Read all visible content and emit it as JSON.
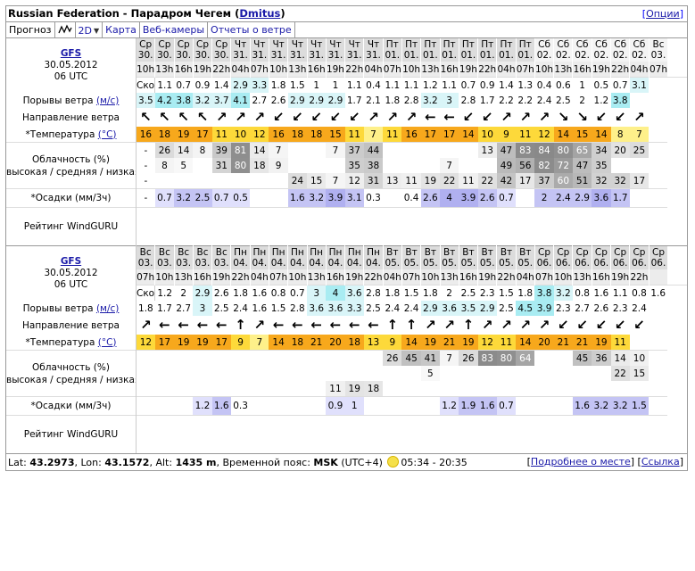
{
  "header": {
    "title": "Russian Federation - Парадром Чегем",
    "user_link": "Dmitus",
    "options_label": "Опции"
  },
  "tabs": [
    {
      "label": "Прогноз",
      "active": true
    },
    {
      "label": "graph-icon",
      "icon": true
    },
    {
      "label": "2D",
      "select": true
    },
    {
      "label": "Карта"
    },
    {
      "label": "Веб-камеры"
    },
    {
      "label": "Отчеты о ветре"
    }
  ],
  "labels": {
    "wind_speed": "Скорость ветра",
    "wind_gust": "Порывы ветра",
    "wind_unit": "(м/с)",
    "wind_dir": "Направление ветра",
    "temp": "*Температура",
    "temp_unit": "(°C)",
    "cloud1": "Облачность (%)",
    "cloud2": "высокая / средняя / низкая",
    "precip": "*Осадки (мм/3ч)",
    "rating": "Рейтинг WindGURU"
  },
  "colors": {
    "wind_light": "#d9f5f8",
    "wind_med": "#a9ecf2",
    "temp_orange": "#f7a81c",
    "temp_yellow": "#fdd93a",
    "temp_lightyellow": "#fef08a",
    "precip_light": "#e0e0fc",
    "precip_med": "#c4c4f4"
  },
  "blocks": [
    {
      "model": "GFS",
      "date": "30.05.2012",
      "utc": "06 UTC",
      "days": [
        "Ср",
        "Ср",
        "Ср",
        "Ср",
        "Ср",
        "Чт",
        "Чт",
        "Чт",
        "Чт",
        "Чт",
        "Чт",
        "Чт",
        "Чт",
        "Пт",
        "Пт",
        "Пт",
        "Пт",
        "Пт",
        "Пт",
        "Пт",
        "Пт",
        "Сб",
        "Сб",
        "Сб",
        "Сб",
        "Сб",
        "Сб",
        "Вс"
      ],
      "dates": [
        "30.",
        "30.",
        "30.",
        "30.",
        "30.",
        "31.",
        "31.",
        "31.",
        "31.",
        "31.",
        "31.",
        "31.",
        "31.",
        "01.",
        "01.",
        "01.",
        "01.",
        "01.",
        "01.",
        "01.",
        "01.",
        "02.",
        "02.",
        "02.",
        "02.",
        "02.",
        "02.",
        "03."
      ],
      "hours": [
        "10h",
        "13h",
        "16h",
        "19h",
        "22h",
        "04h",
        "07h",
        "10h",
        "13h",
        "16h",
        "19h",
        "22h",
        "04h",
        "07h",
        "10h",
        "13h",
        "16h",
        "19h",
        "22h",
        "04h",
        "07h",
        "10h",
        "13h",
        "16h",
        "19h",
        "22h",
        "04h",
        "07h"
      ],
      "weekend_from": 21,
      "speed": [
        "1.1",
        "0.7",
        "0.9",
        "1.4",
        "2.9",
        "3.3",
        "1.8",
        "1.5",
        "1",
        "1",
        "1.1",
        "0.4",
        "1.1",
        "1.1",
        "1.2",
        "1.1",
        "0.7",
        "0.9",
        "1.4",
        "1.3",
        "0.4",
        "0.6",
        "1",
        "0.5",
        "0.7",
        "3.1",
        "",
        ""
      ],
      "gust": [
        "3.5",
        "4.2",
        "3.8",
        "3.2",
        "3.7",
        "4.1",
        "2.7",
        "2.6",
        "2.9",
        "2.9",
        "2.9",
        "1.7",
        "2.1",
        "1.8",
        "2.8",
        "3.2",
        "3",
        "2.8",
        "1.7",
        "2.2",
        "2.2",
        "2.4",
        "2.5",
        "2",
        "1.2",
        "3.8",
        "",
        ""
      ],
      "dir": [
        "↖",
        "↖",
        "↖",
        "↖",
        "↗",
        "↗",
        "↗",
        "↙",
        "↙",
        "↙",
        "↙",
        "↙",
        "↗",
        "↗",
        "↗",
        "←",
        "←",
        "↙",
        "↙",
        "↗",
        "↗",
        "↗",
        "↘",
        "↘",
        "↙",
        "↙",
        "↗",
        ""
      ],
      "temp": [
        "16",
        "18",
        "19",
        "17",
        "11",
        "10",
        "12",
        "16",
        "18",
        "18",
        "15",
        "11",
        "7",
        "11",
        "16",
        "17",
        "17",
        "14",
        "10",
        "9",
        "11",
        "12",
        "14",
        "15",
        "14",
        "8",
        "7",
        ""
      ],
      "cloud_high": [
        "-",
        "26",
        "14",
        "8",
        "39",
        "81",
        "14",
        "7",
        "",
        "",
        "7",
        "37",
        "44",
        "",
        "",
        "",
        "",
        "",
        "13",
        "47",
        "83",
        "84",
        "80",
        "65",
        "34",
        "20",
        "25",
        ""
      ],
      "cloud_mid": [
        "-",
        "8",
        "5",
        "",
        "31",
        "80",
        "18",
        "9",
        "",
        "",
        "",
        "35",
        "38",
        "",
        "",
        "",
        "7",
        "",
        "",
        "49",
        "56",
        "82",
        "72",
        "47",
        "35",
        "",
        ""
      ],
      "cloud_low": [
        "-",
        "",
        "",
        "",
        "",
        "",
        "",
        "",
        "24",
        "15",
        "7",
        "12",
        "31",
        "13",
        "11",
        "19",
        "22",
        "11",
        "22",
        "42",
        "17",
        "37",
        "60",
        "51",
        "32",
        "32",
        "17",
        ""
      ],
      "precip": [
        "-",
        "0.7",
        "3.2",
        "2.5",
        "0.7",
        "0.5",
        "",
        "",
        "1.6",
        "3.2",
        "3.9",
        "3.1",
        "0.3",
        "",
        "0.4",
        "2.6",
        "4",
        "3.9",
        "2.6",
        "0.7",
        "",
        "2",
        "2.4",
        "2.9",
        "3.6",
        "1.7",
        "",
        ""
      ]
    },
    {
      "model": "GFS",
      "date": "30.05.2012",
      "utc": "06 UTC",
      "days": [
        "Вс",
        "Вс",
        "Вс",
        "Вс",
        "Вс",
        "Пн",
        "Пн",
        "Пн",
        "Пн",
        "Пн",
        "Пн",
        "Пн",
        "Пн",
        "Вт",
        "Вт",
        "Вт",
        "Вт",
        "Вт",
        "Вт",
        "Вт",
        "Вт",
        "Ср",
        "Ср",
        "Ср",
        "Ср",
        "Ср",
        "Ср",
        "Ср"
      ],
      "dates": [
        "03.",
        "03.",
        "03.",
        "03.",
        "03.",
        "04.",
        "04.",
        "04.",
        "04.",
        "04.",
        "04.",
        "04.",
        "04.",
        "05.",
        "05.",
        "05.",
        "05.",
        "05.",
        "05.",
        "05.",
        "05.",
        "06.",
        "06.",
        "06.",
        "06.",
        "06.",
        "06.",
        "06."
      ],
      "hours": [
        "07h",
        "10h",
        "13h",
        "16h",
        "19h",
        "22h",
        "04h",
        "07h",
        "10h",
        "13h",
        "16h",
        "19h",
        "22h",
        "04h",
        "07h",
        "10h",
        "13h",
        "16h",
        "19h",
        "22h",
        "04h",
        "07h",
        "10h",
        "13h",
        "16h",
        "19h",
        "22h",
        ""
      ],
      "weekend_from": 0,
      "speed": [
        "1.2",
        "2",
        "2.9",
        "2.6",
        "1.8",
        "1.6",
        "0.8",
        "0.7",
        "3",
        "4",
        "3.6",
        "2.8",
        "1.8",
        "1.5",
        "1.8",
        "2",
        "2.5",
        "2.3",
        "1.5",
        "1.8",
        "3.8",
        "3.2",
        "0.8",
        "1.6",
        "1.1",
        "0.8",
        "1.6",
        ""
      ],
      "gust": [
        "1.8",
        "1.7",
        "2.7",
        "3",
        "2.5",
        "2.4",
        "1.6",
        "1.5",
        "2.8",
        "3.6",
        "3.6",
        "3.3",
        "2.5",
        "2.4",
        "2.4",
        "2.9",
        "3.6",
        "3.5",
        "2.9",
        "2.5",
        "4.5",
        "3.9",
        "2.3",
        "2.7",
        "2.6",
        "2.3",
        "2.4",
        ""
      ],
      "dir": [
        "↗",
        "←",
        "←",
        "←",
        "←",
        "↑",
        "↗",
        "←",
        "←",
        "←",
        "←",
        "←",
        "←",
        "↑",
        "↑",
        "↗",
        "↗",
        "↑",
        "↗",
        "↗",
        "↗",
        "↗",
        "↙",
        "↙",
        "↙",
        "↙",
        "↙",
        ""
      ],
      "temp": [
        "12",
        "17",
        "19",
        "19",
        "17",
        "9",
        "7",
        "14",
        "18",
        "21",
        "20",
        "18",
        "13",
        "9",
        "14",
        "19",
        "21",
        "19",
        "12",
        "11",
        "14",
        "20",
        "21",
        "21",
        "19",
        "11",
        "",
        ""
      ],
      "cloud_high": [
        "",
        "",
        "",
        "",
        "",
        "",
        "",
        "",
        "",
        "",
        "",
        "",
        "",
        "26",
        "45",
        "41",
        "7",
        "26",
        "83",
        "80",
        "64",
        "",
        "",
        "45",
        "36",
        "14",
        "10",
        ""
      ],
      "cloud_mid": [
        "",
        "",
        "",
        "",
        "",
        "",
        "",
        "",
        "",
        "",
        "",
        "",
        "",
        "",
        "",
        "5",
        "",
        "",
        "",
        "",
        "",
        "",
        "",
        "",
        "",
        "22",
        "15",
        ""
      ],
      "cloud_low": [
        "",
        "",
        "",
        "",
        "",
        "",
        "",
        "",
        "",
        "",
        "11",
        "19",
        "18",
        "",
        "",
        "",
        "",
        "",
        "",
        "",
        "",
        "",
        "",
        "",
        "",
        "",
        "",
        ""
      ],
      "precip": [
        "",
        "",
        "",
        "1.2",
        "1.6",
        "0.3",
        "",
        "",
        "",
        "",
        "0.9",
        "1",
        "",
        "",
        "",
        "",
        "1.2",
        "1.9",
        "1.6",
        "0.7",
        "",
        "",
        "",
        "1.6",
        "3.2",
        "3.2",
        "1.5",
        ""
      ]
    }
  ],
  "footer": {
    "lat_label": "Lat:",
    "lat": "43.2973",
    "lon_label": "Lon:",
    "lon": "43.1572",
    "alt_label": "Alt:",
    "alt": "1435 m",
    "tz_label": "Временной пояс:",
    "tz": "MSK",
    "tz_offset": "(UTC+4)",
    "sun": "05:34 - 20:35",
    "more_link": "Подробнее о месте",
    "link": "Ссылка"
  }
}
